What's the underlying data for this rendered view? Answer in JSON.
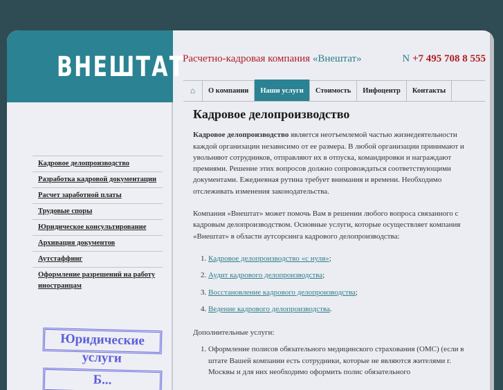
{
  "logo": "ВНЕШТАТ",
  "header": {
    "tagline": "Расчетно-кадровая компания",
    "tagline_brand": "«Внештат»",
    "phone_prefix": "N",
    "phone": "+7 495 708 8 555"
  },
  "nav": {
    "home_icon": "home-icon",
    "items": [
      {
        "label": "О компании"
      },
      {
        "label": "Наши услуги",
        "active": true
      },
      {
        "label": "Стоимость"
      },
      {
        "label": "Инфоцентр"
      },
      {
        "label": "Контакты"
      }
    ]
  },
  "sidebar": {
    "items": [
      {
        "label": "Кадровое делопроизводство"
      },
      {
        "label": "Разработка кадровой документации"
      },
      {
        "label": "Расчет заработной платы"
      },
      {
        "label": "Трудовые споры"
      },
      {
        "label": "Юридическое консультирование"
      },
      {
        "label": "Архивация документов"
      },
      {
        "label": "Аутстаффинг"
      },
      {
        "label": "Оформление разрешений на работу иностранцам"
      }
    ],
    "stamps": [
      "Юридические услуги",
      "Б..."
    ]
  },
  "content": {
    "title": "Кадровое делопроизводство",
    "p1_bold": "Кадровое делопроизводство",
    "p1": " является неотъемлемой частью жизнедеятельности каждой организации независимо от ее размера. В любой организации принимают и увольняют сотрудников, отправляют их в отпуска, командировки и награждают премиями. Решение этих вопросов должно сопровождаться соответствующими документами. Ежедневная рутина требует внимания и времени. Необходимо отслеживать изменения законодательства.",
    "p2": "Компания «Внештат» может помочь Вам в решении любого вопроса связанного с кадровым делопроизводством. Основные услуги, которые осуществляет компания «Внештат» в области аутсорсинга кадрового делопроизводства:",
    "links": [
      {
        "label": "Кадровое делопроизводство «с нуля»",
        "end": ";"
      },
      {
        "label": "Аудит кадрового делопроизводства",
        "end": ";"
      },
      {
        "label": "Восстановление кадрового делопроизводства",
        "end": ";"
      },
      {
        "label": "Ведение кадрового делопроизводства",
        "end": "."
      }
    ],
    "extra_title": "Дополнительные услуги:",
    "extra": [
      "Оформление полисов обязательного медицинского страхования (ОМС) (если в штате Вашей компании есть сотрудники, которые не являются жителями г. Москвы и для них необходимо оформить полис обязательного"
    ]
  }
}
